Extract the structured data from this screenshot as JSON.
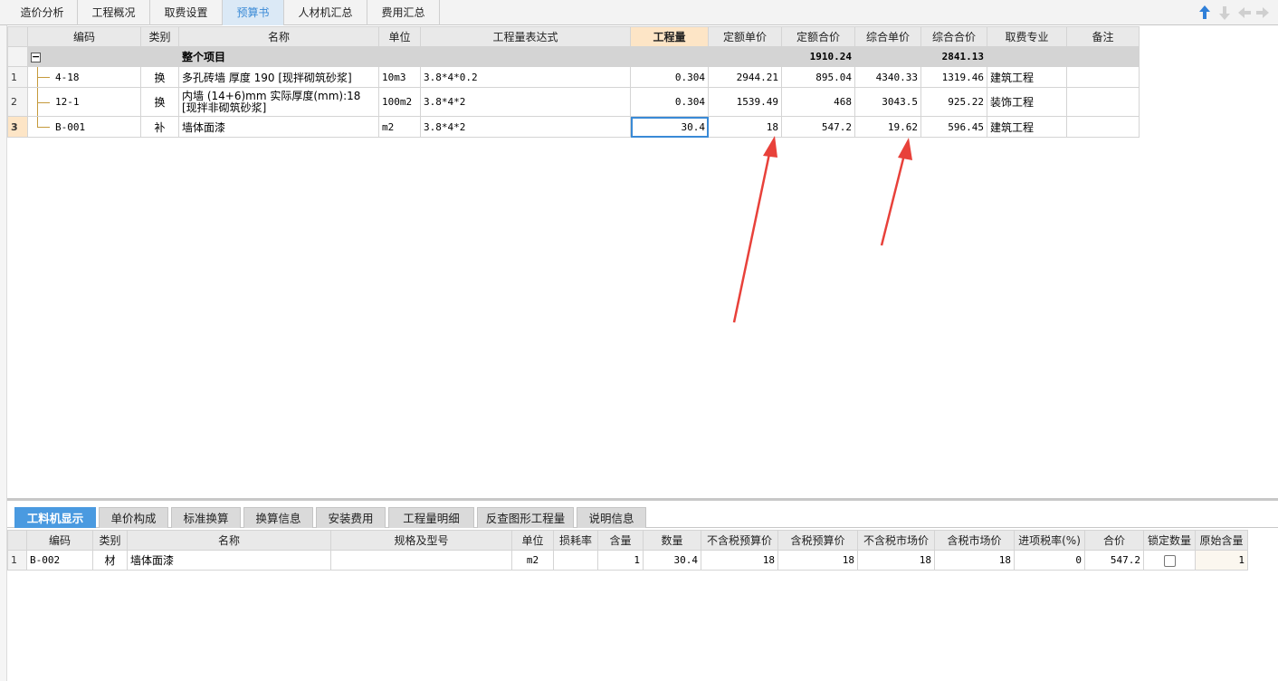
{
  "top_tabs": [
    "造价分析",
    "工程概况",
    "取费设置",
    "预算书",
    "人材机汇总",
    "费用汇总"
  ],
  "active_top_tab": "预算书",
  "main_table": {
    "headers": [
      "编码",
      "类别",
      "名称",
      "单位",
      "工程量表达式",
      "工程量",
      "定额单价",
      "定额合价",
      "综合单价",
      "综合合价",
      "取费专业",
      "备注"
    ],
    "group_row": {
      "name": "整个项目",
      "quota_total": "1910.24",
      "comp_total": "2841.13"
    },
    "rows": [
      {
        "no": "1",
        "code": "4-18",
        "type": "换",
        "name": "多孔砖墙 厚度 190 [现拌砌筑砂浆]",
        "unit": "10m3",
        "expr": "3.8*4*0.2",
        "qty": "0.304",
        "quota_price": "2944.21",
        "quota_total": "895.04",
        "comp_price": "4340.33",
        "comp_total": "1319.46",
        "specialty": "建筑工程",
        "remark": ""
      },
      {
        "no": "2",
        "code": "12-1",
        "type": "换",
        "name": "内墙 (14+6)mm  实际厚度(mm):18  [现拌非砌筑砂浆]",
        "unit": "100m2",
        "expr": "3.8*4*2",
        "qty": "0.304",
        "quota_price": "1539.49",
        "quota_total": "468",
        "comp_price": "3043.5",
        "comp_total": "925.22",
        "specialty": "装饰工程",
        "remark": ""
      },
      {
        "no": "3",
        "code": "B-001",
        "type": "补",
        "name": "墙体面漆",
        "unit": "m2",
        "expr": "3.8*4*2",
        "qty": "30.4",
        "quota_price": "18",
        "quota_total": "547.2",
        "comp_price": "19.62",
        "comp_total": "596.45",
        "specialty": "建筑工程",
        "remark": ""
      }
    ]
  },
  "bottom_tabs": [
    "工料机显示",
    "单价构成",
    "标准换算",
    "换算信息",
    "安装费用",
    "工程量明细",
    "反查图形工程量",
    "说明信息"
  ],
  "active_bottom_tab": "工料机显示",
  "detail_table": {
    "headers": [
      "编码",
      "类别",
      "名称",
      "规格及型号",
      "单位",
      "损耗率",
      "含量",
      "数量",
      "不含税预算价",
      "含税预算价",
      "不含税市场价",
      "含税市场价",
      "进项税率(%)",
      "合价",
      "锁定数量",
      "原始含量"
    ],
    "rows": [
      {
        "no": "1",
        "code": "B-002",
        "type": "材",
        "name": "墙体面漆",
        "spec": "",
        "unit": "m2",
        "loss": "",
        "content": "1",
        "qty": "30.4",
        "pre_tax_budget": "18",
        "tax_budget": "18",
        "pre_tax_market": "18",
        "tax_market": "18",
        "tax_rate": "0",
        "total": "547.2",
        "lock": false,
        "orig_content": "1"
      }
    ]
  },
  "colors": {
    "active_tab_bg": "#dbe9f6",
    "active_tab_text": "#3a8ad6",
    "highlight_header": "#fde5c6",
    "bottom_active_tab": "#4a9ae0",
    "annotation_arrow": "#e8413a",
    "tree_line": "#c59a3c"
  },
  "icons": [
    "move-up-icon",
    "move-down-icon",
    "move-left-icon",
    "move-right-icon",
    "collapse-icon"
  ]
}
